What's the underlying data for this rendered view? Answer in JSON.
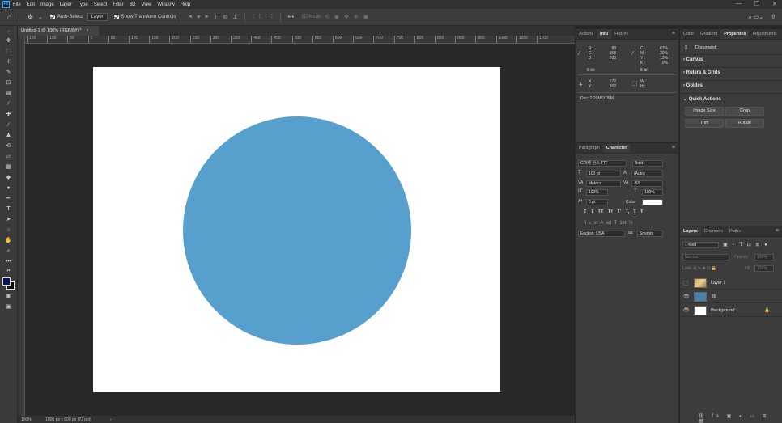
{
  "app": {
    "logo": "Ps"
  },
  "menu": [
    "File",
    "Edit",
    "Image",
    "Layer",
    "Type",
    "Select",
    "Filter",
    "3D",
    "View",
    "Window",
    "Help"
  ],
  "options": {
    "auto_select_label": "Auto-Select:",
    "auto_select_value": "Layer",
    "transform_label": "Show Transform Controls",
    "three_d_mode": "3D Mode:"
  },
  "document": {
    "tab_title": "Untitled-1 @ 100% (RGB/8#) *",
    "canvas_color": "#ffffff",
    "circle_color": "#579fcc",
    "zoom": "100%",
    "size_info": "1000 px x 800 px (72 ppi)"
  },
  "ruler_labels": [
    "150",
    "100",
    "50",
    "0",
    "50",
    "100",
    "150",
    "200",
    "250",
    "300",
    "350",
    "400",
    "450",
    "500",
    "550",
    "600",
    "650",
    "700",
    "750",
    "800",
    "850",
    "900",
    "950",
    "1000",
    "1050",
    "1100"
  ],
  "info_panel": {
    "tabs": [
      "Actions",
      "Info",
      "History"
    ],
    "r_label": "R :",
    "g_label": "G :",
    "b_label": "B :",
    "r": "88",
    "g": "158",
    "b": "203",
    "c_label": "C :",
    "m_label": "M :",
    "y_label": "Y :",
    "k_label": "K :",
    "c": "67%",
    "m": "30%",
    "y": "13%",
    "k": "0%",
    "bit1": "8-bit",
    "bit2": "8-bit",
    "x_label": "X :",
    "ylab": "Y :",
    "x": "572",
    "yv": "362",
    "w_label": "W :",
    "h_label": "H :",
    "doc": "Doc: 2.29M/3.05M"
  },
  "character_panel": {
    "tabs": [
      "Paragraph",
      "Character"
    ],
    "font_family": "G마켓 산스 TTF",
    "font_style": "Bold",
    "font_size": "100 pt",
    "leading": "(Auto)",
    "kerning": "Metrics",
    "tracking": "-50",
    "vscale": "100%",
    "hscale": "100%",
    "baseline": "0 pt",
    "color_label": "Color:",
    "language": "English: USA",
    "antialias": "Smooth",
    "style_buttons": [
      "T",
      "T",
      "TT",
      "Tт",
      "T'",
      "T,",
      "T",
      "Ŧ"
    ]
  },
  "properties_panel": {
    "tabs": [
      "Color",
      "Gradient",
      "Properties",
      "Adjustments"
    ],
    "doc_label": "Document",
    "sections": [
      "Canvas",
      "Rulers & Grids",
      "Guides",
      "Quick Actions"
    ],
    "buttons": [
      "Image Size",
      "Crop",
      "Trim",
      "Rotate"
    ]
  },
  "layers_panel": {
    "tabs": [
      "Layers",
      "Channels",
      "Paths"
    ],
    "kind": "Kind",
    "blend": "Normal",
    "opacity_label": "Opacity:",
    "opacity": "100%",
    "lock_label": "Lock:",
    "fill_label": "Fill:",
    "fill": "100%",
    "layers": [
      {
        "name": "Layer 1",
        "visible": false
      },
      {
        "name": "",
        "visible": true
      },
      {
        "name": "Background",
        "visible": true
      }
    ]
  }
}
